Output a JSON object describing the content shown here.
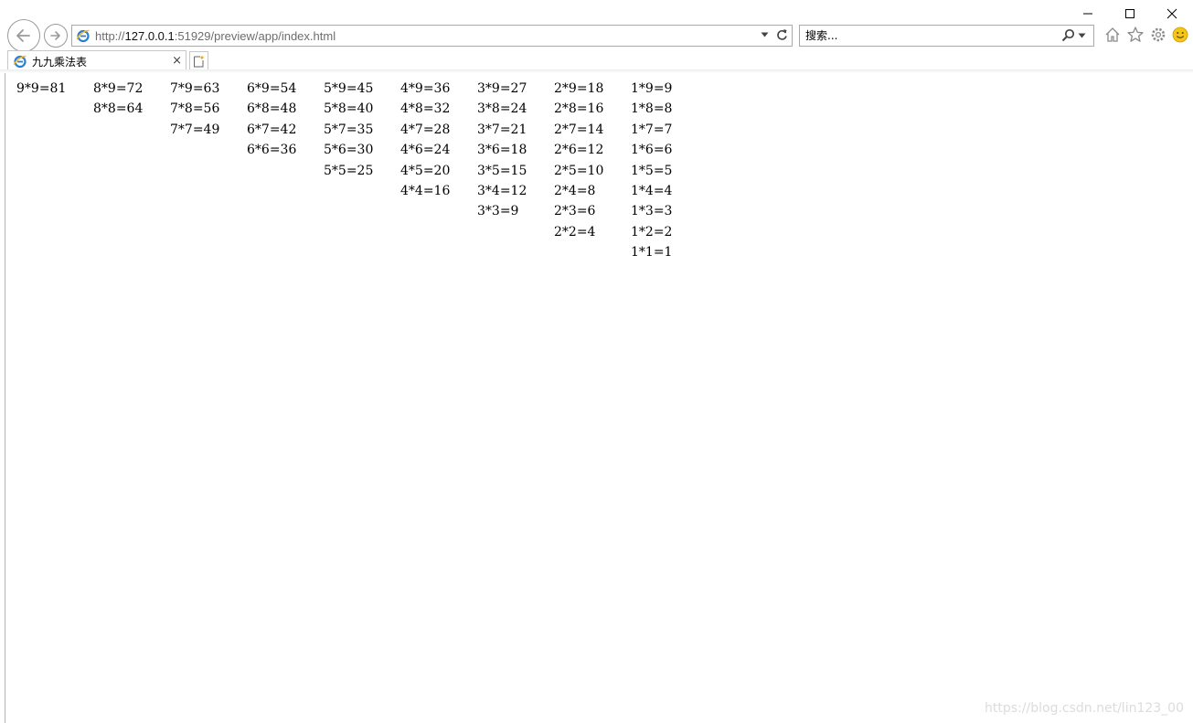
{
  "browser": {
    "url": {
      "scheme": "http://",
      "host": "127.0.0.1",
      "rest": ":51929/preview/app/index.html"
    },
    "search_placeholder": "搜索...",
    "tab_title": "九九乘法表",
    "tab_close": "×"
  },
  "table": {
    "columns": [
      [
        "9*9=81"
      ],
      [
        "8*9=72",
        "8*8=64"
      ],
      [
        "7*9=63",
        "7*8=56",
        "7*7=49"
      ],
      [
        "6*9=54",
        "6*8=48",
        "6*7=42",
        "6*6=36"
      ],
      [
        "5*9=45",
        "5*8=40",
        "5*7=35",
        "5*6=30",
        "5*5=25"
      ],
      [
        "4*9=36",
        "4*8=32",
        "4*7=28",
        "4*6=24",
        "4*5=20",
        "4*4=16"
      ],
      [
        "3*9=27",
        "3*8=24",
        "3*7=21",
        "3*6=18",
        "3*5=15",
        "3*4=12",
        "3*3=9"
      ],
      [
        "2*9=18",
        "2*8=16",
        "2*7=14",
        "2*6=12",
        "2*5=10",
        "2*4=8",
        "2*3=6",
        "2*2=4"
      ],
      [
        "1*9=9",
        "1*8=8",
        "1*7=7",
        "1*6=6",
        "1*5=5",
        "1*4=4",
        "1*3=3",
        "1*2=2",
        "1*1=1"
      ]
    ]
  },
  "watermark": "https://blog.csdn.net/lin123_00",
  "colors": {
    "accent": "#1e88e5",
    "ie_logo": "#2a7fd4",
    "smiley": "#f5c518"
  },
  "icons": [
    "back-arrow-icon",
    "forward-arrow-icon",
    "ie-logo-icon",
    "dropdown-arrow-icon",
    "refresh-icon",
    "search-icon",
    "home-icon",
    "star-icon",
    "gear-icon",
    "smiley-icon",
    "minimize-icon",
    "maximize-icon",
    "close-icon",
    "new-tab-icon"
  ]
}
